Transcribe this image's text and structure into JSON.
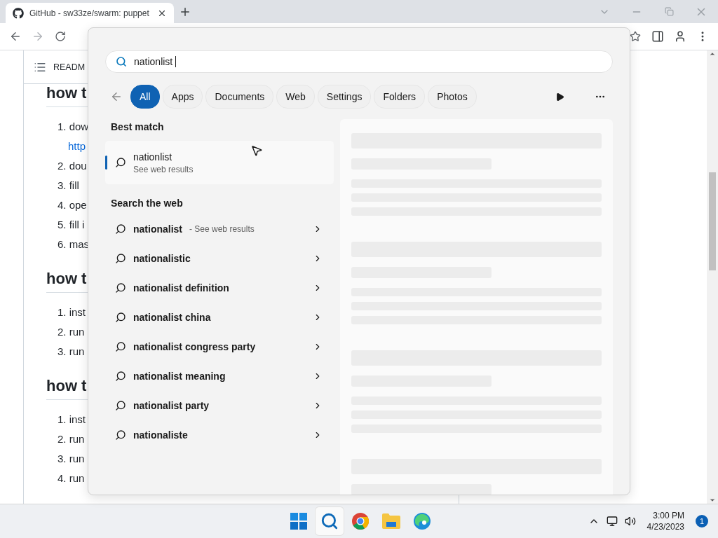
{
  "browser": {
    "tab": {
      "title": "GitHub - sw33ze/swarm: puppet",
      "selected": true
    }
  },
  "page": {
    "toc_label": "READM",
    "sections": [
      {
        "heading": "how t",
        "items": [
          {
            "text": "1. dow",
            "kind": "text"
          },
          {
            "text": "http",
            "kind": "link"
          },
          {
            "text": "2. dou",
            "kind": "text"
          },
          {
            "text": "3. fill",
            "kind": "text"
          },
          {
            "text": "4. ope",
            "kind": "text"
          },
          {
            "text": "5. fill i",
            "kind": "text"
          },
          {
            "text": "6. mas",
            "kind": "text"
          }
        ]
      },
      {
        "heading": "how t",
        "items": [
          {
            "text": "1. inst",
            "kind": "text"
          },
          {
            "text": "2. run",
            "kind": "text"
          },
          {
            "text": "3. run",
            "kind": "text"
          }
        ]
      },
      {
        "heading": "how t",
        "items": [
          {
            "text": "1. inst",
            "kind": "text"
          },
          {
            "text": "2. run",
            "kind": "text"
          },
          {
            "text": "3. run",
            "kind": "text"
          },
          {
            "text": "4. run",
            "kind": "text"
          }
        ]
      }
    ]
  },
  "search": {
    "query": "nationlist",
    "filters": [
      {
        "label": "All",
        "selected": true
      },
      {
        "label": "Apps",
        "selected": false
      },
      {
        "label": "Documents",
        "selected": false
      },
      {
        "label": "Web",
        "selected": false
      },
      {
        "label": "Settings",
        "selected": false
      },
      {
        "label": "Folders",
        "selected": false
      },
      {
        "label": "Photos",
        "selected": false
      }
    ],
    "best_match_label": "Best match",
    "best_match": {
      "title": "nationlist",
      "subtitle": "See web results",
      "selected": true
    },
    "web_label": "Search the web",
    "suggestions": [
      {
        "text": "nationalist",
        "hint": "- See web results"
      },
      {
        "text": "nationalistic"
      },
      {
        "text": "nationalist definition"
      },
      {
        "text": "nationalist china"
      },
      {
        "text": "nationalist congress party"
      },
      {
        "text": "nationalist meaning"
      },
      {
        "text": "nationalist party"
      },
      {
        "text": "nationaliste"
      }
    ]
  },
  "taskbar": {
    "apps": [
      {
        "kind": "start",
        "selected": false
      },
      {
        "kind": "search",
        "selected": true
      },
      {
        "kind": "chrome",
        "selected": false
      },
      {
        "kind": "folder",
        "selected": false
      },
      {
        "kind": "edge",
        "selected": false
      }
    ],
    "time": "3:00 PM",
    "date": "4/23/2023",
    "notifications": "1"
  }
}
